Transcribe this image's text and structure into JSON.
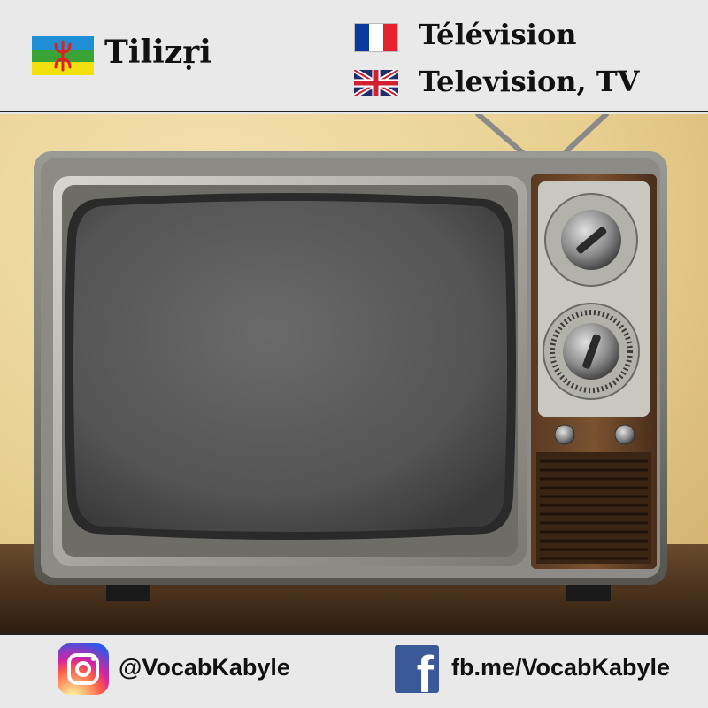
{
  "header": {
    "kabyle_word": "Tilizṛi",
    "french_word": "Télévision",
    "english_word": "Television, TV",
    "kabyle_flag_icon": "amazigh-flag-icon",
    "french_flag_icon": "france-flag-icon",
    "english_flag_icon": "uk-flag-icon",
    "colors": {
      "amazigh_blue": "#1e8fd6",
      "amazigh_green": "#3aa335",
      "amazigh_yellow": "#f5e00f",
      "amazigh_red": "#e02020",
      "france_blue": "#0a3aa0",
      "france_red": "#e8212e",
      "uk_blue": "#1f2d6b",
      "uk_red": "#d22030"
    }
  },
  "photo": {
    "subject_icon": "vintage-tv-icon"
  },
  "footer": {
    "instagram_handle": "@VocabKabyle",
    "facebook_link": "fb.me/VocabKabyle",
    "instagram_icon": "instagram-icon",
    "facebook_icon": "facebook-icon",
    "colors": {
      "facebook_blue": "#3b5998"
    }
  }
}
